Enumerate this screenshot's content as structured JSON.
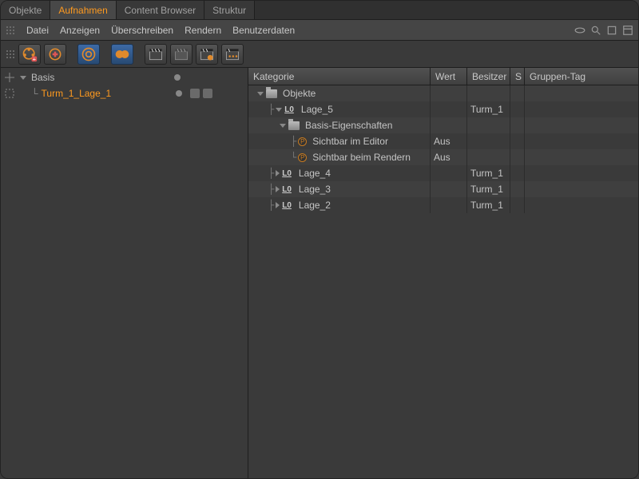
{
  "tabs": [
    {
      "label": "Objekte",
      "active": false
    },
    {
      "label": "Aufnahmen",
      "active": true
    },
    {
      "label": "Content Browser",
      "active": false
    },
    {
      "label": "Struktur",
      "active": false
    }
  ],
  "menu": {
    "datei": "Datei",
    "anzeigen": "Anzeigen",
    "ueberschreiben": "Überschreiben",
    "rendern": "Rendern",
    "benutzerdaten": "Benutzerdaten"
  },
  "toolbar_icons": [
    "reel-add",
    "reel-plus",
    "spiral-record",
    "peanut-link",
    "clapper-a",
    "clapper-disabled",
    "clapper-orange",
    "clapper-dots"
  ],
  "left_tree": {
    "root": {
      "label": "Basis"
    },
    "child": {
      "label": "Turm_1_Lage_1"
    }
  },
  "columns": {
    "kategorie": "Kategorie",
    "wert": "Wert",
    "besitzer": "Besitzer",
    "s": "S",
    "gruppen_tag": "Gruppen-Tag"
  },
  "rows": [
    {
      "indent": 0,
      "kind": "folder-open",
      "label": "Objekte",
      "wert": "",
      "owner": ""
    },
    {
      "indent": 1,
      "kind": "lo-open",
      "label": "Lage_5",
      "wert": "",
      "owner": "Turm_1"
    },
    {
      "indent": 2,
      "kind": "folder-open",
      "label": "Basis-Eigenschaften",
      "wert": "",
      "owner": ""
    },
    {
      "indent": 3,
      "kind": "param",
      "label": "Sichtbar im Editor",
      "wert": "Aus",
      "owner": ""
    },
    {
      "indent": 3,
      "kind": "param-last",
      "label": "Sichtbar beim Rendern",
      "wert": "Aus",
      "owner": ""
    },
    {
      "indent": 1,
      "kind": "lo-closed",
      "label": "Lage_4",
      "wert": "",
      "owner": "Turm_1"
    },
    {
      "indent": 1,
      "kind": "lo-closed",
      "label": "Lage_3",
      "wert": "",
      "owner": "Turm_1"
    },
    {
      "indent": 1,
      "kind": "lo-closed",
      "label": "Lage_2",
      "wert": "",
      "owner": "Turm_1"
    }
  ]
}
